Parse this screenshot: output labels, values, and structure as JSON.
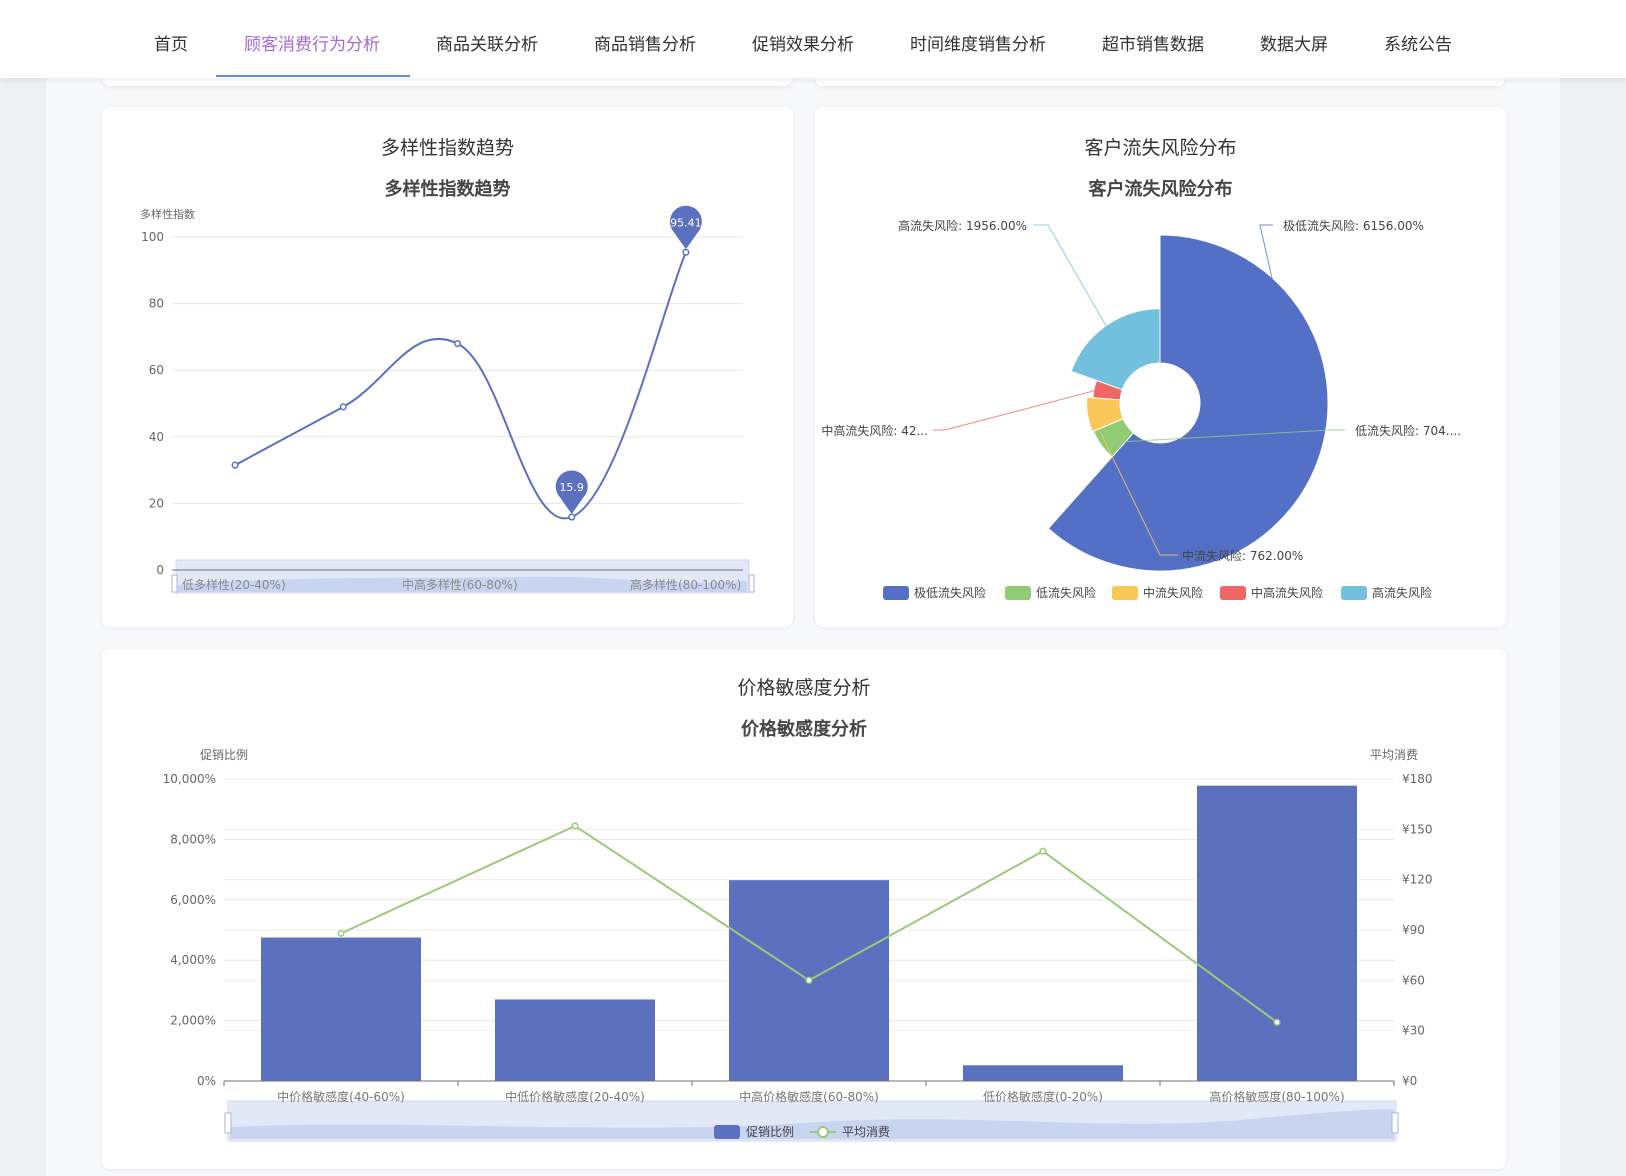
{
  "nav": {
    "items": [
      {
        "label": "首页",
        "active": false
      },
      {
        "label": "顾客消费行为分析",
        "active": true
      },
      {
        "label": "商品关联分析",
        "active": false
      },
      {
        "label": "商品销售分析",
        "active": false
      },
      {
        "label": "促销效果分析",
        "active": false
      },
      {
        "label": "时间维度销售分析",
        "active": false
      },
      {
        "label": "超市销售数据",
        "active": false
      },
      {
        "label": "数据大屏",
        "active": false
      },
      {
        "label": "系统公告",
        "active": false
      }
    ],
    "active_color": "#a56ad4",
    "underline_color": "#5b8fd6"
  },
  "cards": {
    "diversity": {
      "card_title": "多样性指数趋势"
    },
    "churn": {
      "card_title": "客户流失风险分布"
    },
    "price": {
      "card_title": "价格敏感度分析"
    }
  },
  "chart_data": [
    {
      "type": "line",
      "title": "多样性指数趋势",
      "ylabel": "多样性指数",
      "ylim": [
        0,
        100
      ],
      "yticks": [
        "0",
        "20",
        "40",
        "60",
        "80",
        "100"
      ],
      "x_tick_labels": [
        "低多样性(20-40%)",
        "中高多样性(60-80%)",
        "高多样性(80-100%)"
      ],
      "values": [
        31.5,
        49,
        68,
        15.9,
        95.41
      ],
      "markpoints": [
        {
          "label": "15.9",
          "value": 15.9,
          "index": 3
        },
        {
          "label": "95.41",
          "value": 95.41,
          "index": 4
        }
      ],
      "color": "#5b71c0",
      "smooth": true,
      "grid": true,
      "datazoom": true
    },
    {
      "type": "pie",
      "variant": "rose",
      "title": "客户流失风险分布",
      "slices": [
        {
          "name": "极低流失风险",
          "value": 6156.0,
          "label": "极低流失风险: 6156.00%",
          "color": "#5470c6"
        },
        {
          "name": "低流失风险",
          "value": 704.0,
          "label": "低流失风险: 704....",
          "color": "#91cc75"
        },
        {
          "name": "中流失风险",
          "value": 762.0,
          "label": "中流失风险: 762.00%",
          "color": "#fac858"
        },
        {
          "name": "中高流失风险",
          "value": 420.0,
          "label": "中高流失风险: 42...",
          "color": "#ee6666"
        },
        {
          "name": "高流失风险",
          "value": 1956.0,
          "label": "高流失风险: 1956.00%",
          "color": "#73c0de"
        }
      ],
      "legend": [
        "极低流失风险",
        "低流失风险",
        "中流失风险",
        "中高流失风险",
        "高流失风险"
      ],
      "legend_position": "bottom"
    },
    {
      "type": "bar",
      "title": "价格敏感度分析",
      "categories": [
        "中价格敏感度(40-60%)",
        "中低价格敏感度(20-40%)",
        "中高价格敏感度(60-80%)",
        "低价格敏感度(0-20%)",
        "高价格敏感度(80-100%)"
      ],
      "series": [
        {
          "name": "促销比例",
          "type": "bar",
          "axis": "left",
          "values": [
            4750,
            2700,
            6650,
            520,
            9780
          ],
          "color": "#5b71c0"
        },
        {
          "name": "平均消费",
          "type": "line",
          "axis": "right",
          "values": [
            88,
            152,
            60,
            137,
            35
          ],
          "color": "#9bc979"
        }
      ],
      "left_axis": {
        "label": "促销比例",
        "ylim": [
          0,
          10000
        ],
        "ticks": [
          "0%",
          "2,000%",
          "4,000%",
          "6,000%",
          "8,000%",
          "10,000%"
        ]
      },
      "right_axis": {
        "label": "平均消费",
        "ylim": [
          0,
          180
        ],
        "ticks": [
          "¥0",
          "¥30",
          "¥60",
          "¥90",
          "¥120",
          "¥150",
          "¥180"
        ]
      },
      "legend": [
        "促销比例",
        "平均消费"
      ],
      "legend_position": "bottom",
      "grid": true,
      "datazoom": true
    }
  ]
}
